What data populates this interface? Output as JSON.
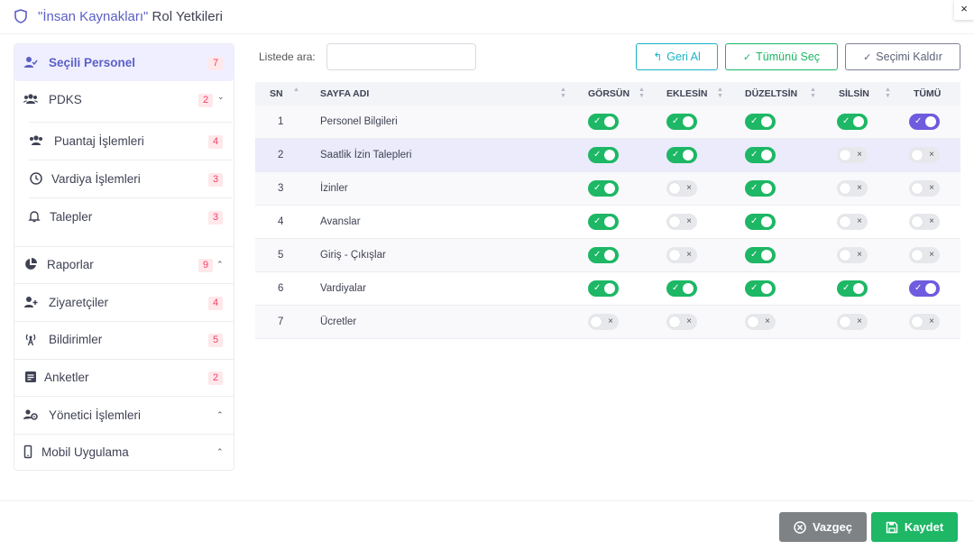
{
  "header": {
    "quoted_name": "\"İnsan Kaynakları\"",
    "title_rest": " Rol Yetkileri",
    "close_glyph": "×",
    "accent": "#5b5fc7"
  },
  "sidebar": {
    "items": [
      {
        "label": "Seçili Personel",
        "badge": "7",
        "icon": "user-check-icon"
      },
      {
        "label": "PDKS",
        "badge": "2",
        "icon": "users-icon",
        "chevron": "⌄"
      },
      {
        "label": "Puantaj İşlemleri",
        "badge": "4",
        "icon": "users-icon"
      },
      {
        "label": "Vardiya İşlemleri",
        "badge": "3",
        "icon": "clock-icon"
      },
      {
        "label": "Talepler",
        "badge": "3",
        "icon": "bell-icon"
      },
      {
        "label": "Raporlar",
        "badge": "9",
        "icon": "pie-chart-icon",
        "chevron": "⌃"
      },
      {
        "label": "Ziyaretçiler",
        "badge": "4",
        "icon": "user-plus-icon"
      },
      {
        "label": "Bildirimler",
        "badge": "5",
        "icon": "broadcast-icon"
      },
      {
        "label": "Anketler",
        "badge": "2",
        "icon": "survey-icon"
      },
      {
        "label": "Yönetici İşlemleri",
        "icon": "users-cog-icon",
        "chevron": "⌃"
      },
      {
        "label": "Mobil Uygulama",
        "icon": "mobile-icon",
        "chevron": "⌃"
      }
    ]
  },
  "toolbar": {
    "search_label": "Listede ara:",
    "search_value": "",
    "undo_label": "Geri Al",
    "select_all_label": "Tümünü Seç",
    "clear_label": "Seçimi Kaldır"
  },
  "table": {
    "columns": [
      "SN",
      "SAYFA ADI",
      "GÖRSÜN",
      "EKLESİN",
      "DÜZELTSİN",
      "SİLSİN",
      "TÜMÜ"
    ],
    "rows": [
      {
        "sn": "1",
        "name": "Personel Bilgileri",
        "toggles": [
          true,
          true,
          true,
          true,
          true
        ]
      },
      {
        "sn": "2",
        "name": "Saatlik İzin Talepleri",
        "toggles": [
          true,
          true,
          true,
          false,
          false
        ]
      },
      {
        "sn": "3",
        "name": "İzinler",
        "toggles": [
          true,
          false,
          true,
          false,
          false
        ]
      },
      {
        "sn": "4",
        "name": "Avanslar",
        "toggles": [
          true,
          false,
          true,
          false,
          false
        ]
      },
      {
        "sn": "5",
        "name": "Giriş - Çıkışlar",
        "toggles": [
          true,
          false,
          true,
          false,
          false
        ]
      },
      {
        "sn": "6",
        "name": "Vardiyalar",
        "toggles": [
          true,
          true,
          true,
          true,
          true
        ]
      },
      {
        "sn": "7",
        "name": "Ücretler",
        "toggles": [
          false,
          false,
          false,
          false,
          false
        ]
      }
    ],
    "on_color": "#1db765",
    "all_on_color": "#6e5bdd"
  },
  "footer": {
    "cancel_label": "Vazgeç",
    "save_label": "Kaydet"
  }
}
